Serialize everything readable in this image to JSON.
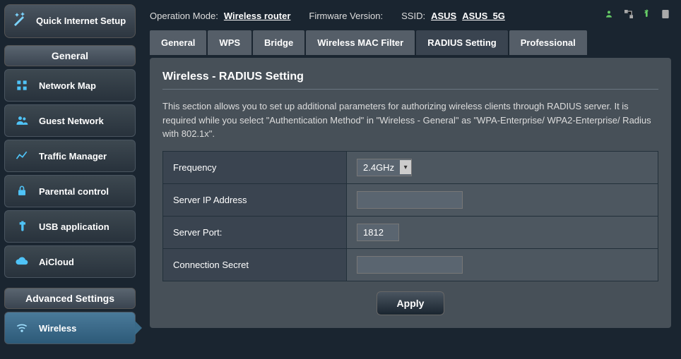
{
  "quick_setup": {
    "label": "Quick Internet Setup"
  },
  "sidebar": {
    "general_header": "General",
    "general_items": [
      {
        "label": "Network Map"
      },
      {
        "label": "Guest Network"
      },
      {
        "label": "Traffic Manager"
      },
      {
        "label": "Parental control"
      },
      {
        "label": "USB application"
      },
      {
        "label": "AiCloud"
      }
    ],
    "advanced_header": "Advanced Settings",
    "advanced_items": [
      {
        "label": "Wireless"
      }
    ]
  },
  "topbar": {
    "op_mode_label": "Operation Mode:",
    "op_mode_value": "Wireless router",
    "fw_label": "Firmware Version:",
    "ssid_label": "SSID:",
    "ssid1": "ASUS",
    "ssid2": "ASUS_5G"
  },
  "tabs": [
    "General",
    "WPS",
    "Bridge",
    "Wireless MAC Filter",
    "RADIUS Setting",
    "Professional"
  ],
  "active_tab_index": 4,
  "page": {
    "title": "Wireless - RADIUS Setting",
    "description": "This section allows you to set up additional parameters for authorizing wireless clients through RADIUS server. It is required while you select \"Authentication Method\" in \"Wireless - General\" as \"WPA-Enterprise/ WPA2-Enterprise/ Radius with 802.1x\"."
  },
  "form": {
    "frequency": {
      "label": "Frequency",
      "value": "2.4GHz"
    },
    "server_ip": {
      "label": "Server IP Address",
      "value": ""
    },
    "server_port": {
      "label": "Server Port:",
      "value": "1812"
    },
    "secret": {
      "label": "Connection Secret",
      "value": ""
    },
    "apply_label": "Apply"
  }
}
